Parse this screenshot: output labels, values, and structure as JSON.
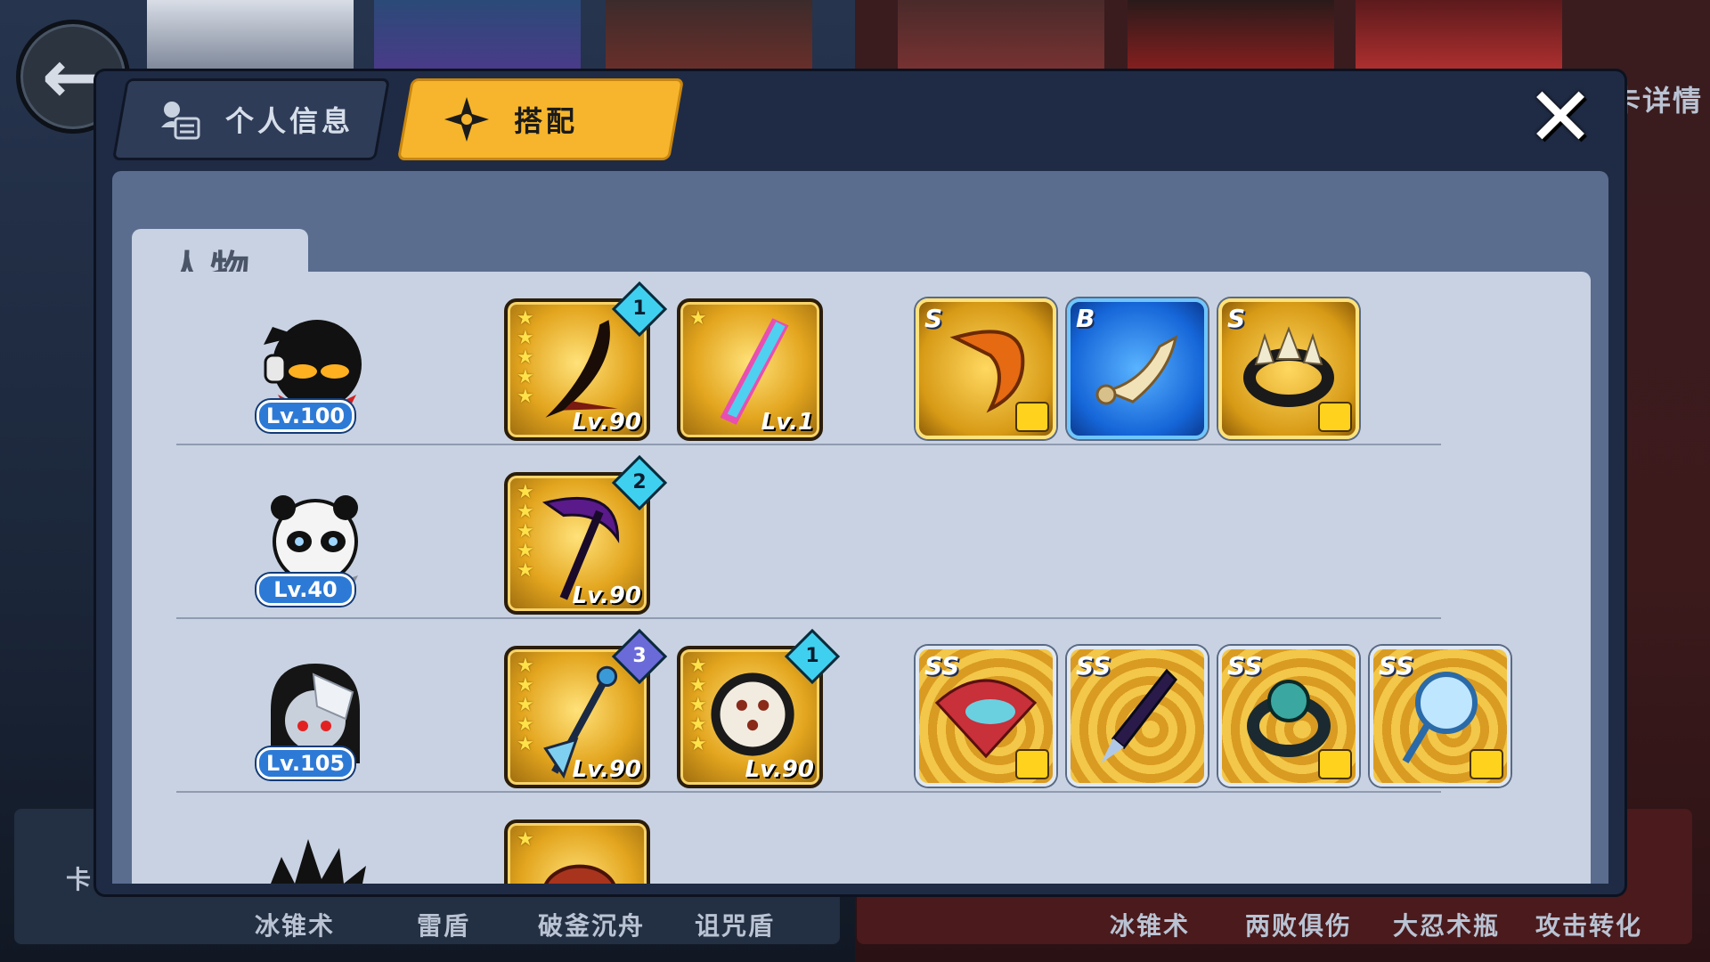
{
  "tabs": {
    "profile_label": "个人信息",
    "match_label": "搭配"
  },
  "background": {
    "right_top_label": "卡详情",
    "left_card_label": "卡",
    "left_skills": [
      "冰锥术",
      "雷盾",
      "破釜沉舟",
      "诅咒盾"
    ],
    "right_skills": [
      "冰锥术",
      "两败俱伤",
      "大忍术瓶",
      "攻击转化"
    ]
  },
  "section": {
    "title": "人物"
  },
  "characters": [
    {
      "avatar_icon": "stickman-headphones-icon",
      "level": "Lv.100",
      "weapons": [
        {
          "icon": "scythe-icon",
          "stars": 5,
          "level": "Lv.90",
          "badge": "1"
        },
        {
          "icon": "phone-blade-icon",
          "stars": 1,
          "level": "Lv.1",
          "badge": ""
        }
      ],
      "equipment": [
        {
          "icon": "horn-icon",
          "rank": "S",
          "style": "gold",
          "shirt": true
        },
        {
          "icon": "scroll-icon",
          "rank": "B",
          "style": "blue",
          "shirt": false
        },
        {
          "icon": "spiked-ring-icon",
          "rank": "S",
          "style": "gold",
          "shirt": true
        }
      ]
    },
    {
      "avatar_icon": "panda-ninja-icon",
      "level": "Lv.40",
      "weapons": [
        {
          "icon": "purple-scythe-icon",
          "stars": 5,
          "level": "Lv.90",
          "badge": "2"
        }
      ],
      "equipment": []
    },
    {
      "avatar_icon": "ghost-girl-icon",
      "level": "Lv.105",
      "weapons": [
        {
          "icon": "trident-spear-icon",
          "stars": 5,
          "level": "Lv.90",
          "badge": "3"
        },
        {
          "icon": "tomoe-shield-icon",
          "stars": 5,
          "level": "Lv.90",
          "badge": "1"
        }
      ],
      "equipment": [
        {
          "icon": "fish-fan-icon",
          "rank": "SS",
          "style": "ss",
          "shirt": true
        },
        {
          "icon": "kunai-icon",
          "rank": "SS",
          "style": "ss",
          "shirt": false
        },
        {
          "icon": "water-ring-icon",
          "rank": "SS",
          "style": "ss",
          "shirt": true
        },
        {
          "icon": "ice-mirror-icon",
          "rank": "SS",
          "style": "ss",
          "shirt": true
        }
      ]
    },
    {
      "avatar_icon": "spiky-hair-ninja-icon",
      "level": "",
      "weapons": [
        {
          "icon": "meat-club-icon",
          "stars": 1,
          "level": "",
          "badge": ""
        }
      ],
      "equipment": []
    }
  ],
  "colors": {
    "tab_active": "#f6b52c",
    "level_badge": "#2d7ad6",
    "star": "#ffe14a"
  }
}
